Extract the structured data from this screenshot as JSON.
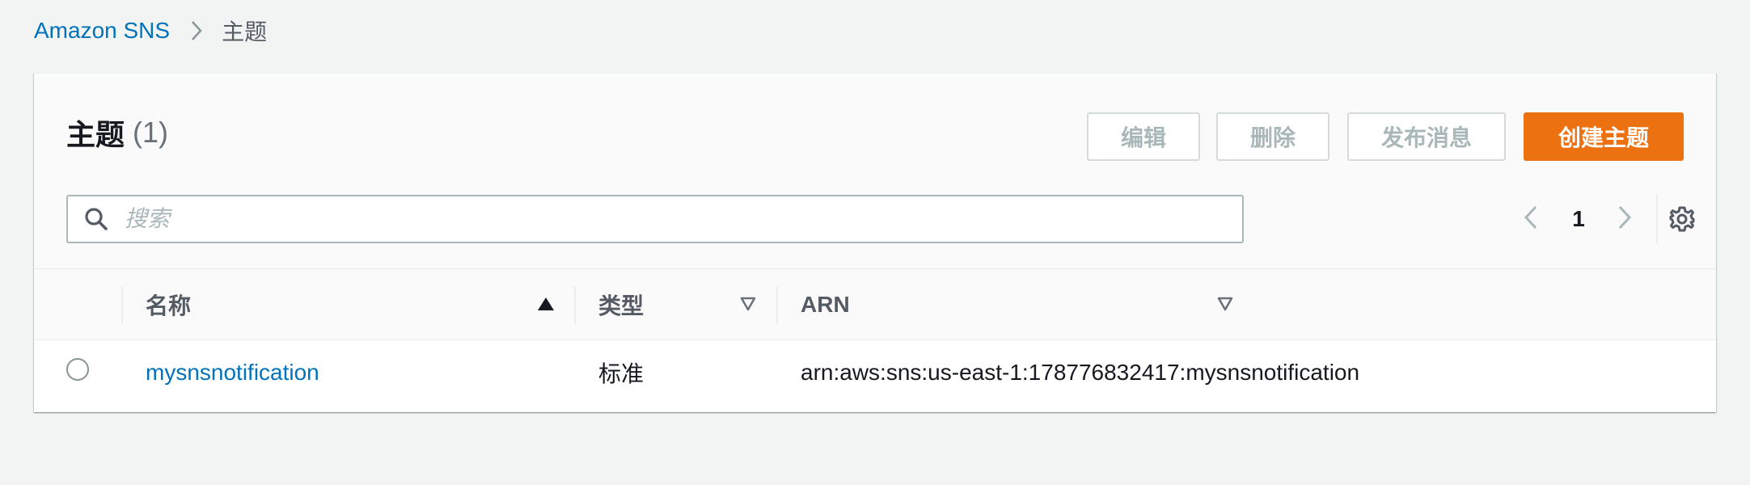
{
  "breadcrumb": {
    "root": "Amazon SNS",
    "current": "主题"
  },
  "header": {
    "title": "主题",
    "count": "(1)"
  },
  "actions": {
    "edit": "编辑",
    "delete": "删除",
    "publish": "发布消息",
    "create": "创建主题"
  },
  "search": {
    "placeholder": "搜索",
    "value": ""
  },
  "pagination": {
    "current_page": "1"
  },
  "table": {
    "columns": [
      {
        "label": "名称",
        "sort": "ascending"
      },
      {
        "label": "类型",
        "sort": "none"
      },
      {
        "label": "ARN",
        "sort": "none"
      }
    ],
    "rows": [
      {
        "selected": false,
        "name": "mysnsnotification",
        "type": "标准",
        "arn": "arn:aws:sns:us-east-1:178776832417:mysnsnotification"
      }
    ]
  },
  "colors": {
    "accent": "#ec7211",
    "link": "#0073bb",
    "disabled_text": "#aab7b8"
  },
  "icons": {
    "breadcrumb_separator": "chevron-right-icon",
    "search": "search-icon",
    "prev": "chevron-left-icon",
    "next": "chevron-right-icon",
    "settings": "gear-icon",
    "sort_asc": "caret-up-filled-icon",
    "sort_none": "caret-down-outline-icon"
  }
}
